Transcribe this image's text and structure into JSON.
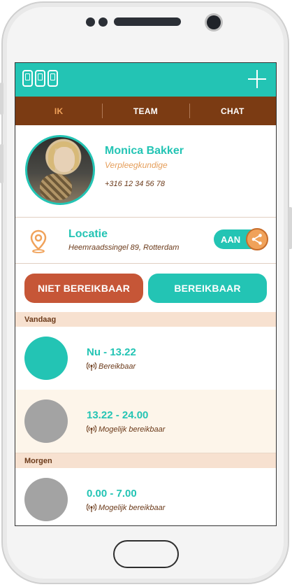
{
  "colors": {
    "accent": "#23c4b4",
    "tab_bar": "#7b3b13",
    "active_tab": "#f0a25a",
    "not_available": "#c65637",
    "text_brown": "#6b3a1a",
    "inactive_slot": "#a3a3a3"
  },
  "tabs": [
    {
      "label": "IK",
      "active": true
    },
    {
      "label": "TEAM",
      "active": false
    },
    {
      "label": "CHAT",
      "active": false
    }
  ],
  "profile": {
    "name": "Monica Bakker",
    "role": "Verpleegkundige",
    "phone": "+316 12 34 56 78"
  },
  "location": {
    "title": "Locatie",
    "address": "Heemraadssingel 89, Rotterdam",
    "toggle_label": "AAN"
  },
  "actions": {
    "not_available": "NIET BEREIKBAAR",
    "available": "BEREIKBAAR"
  },
  "schedule": [
    {
      "day": "Vandaag",
      "slots": [
        {
          "time": "Nu - 13.22",
          "status": "Bereikbaar",
          "color": "#23c4b4"
        },
        {
          "time": "13.22 - 24.00",
          "status": "Mogelijk bereikbaar",
          "color": "#a3a3a3"
        }
      ]
    },
    {
      "day": "Morgen",
      "slots": [
        {
          "time": "0.00 - 7.00",
          "status": "Mogelijk bereikbaar",
          "color": "#a3a3a3"
        }
      ]
    }
  ],
  "icons": {
    "logo": "team-phones-logo",
    "add": "plus-icon",
    "location": "location-pin-icon",
    "share": "share-icon",
    "status": "signal-icon"
  }
}
